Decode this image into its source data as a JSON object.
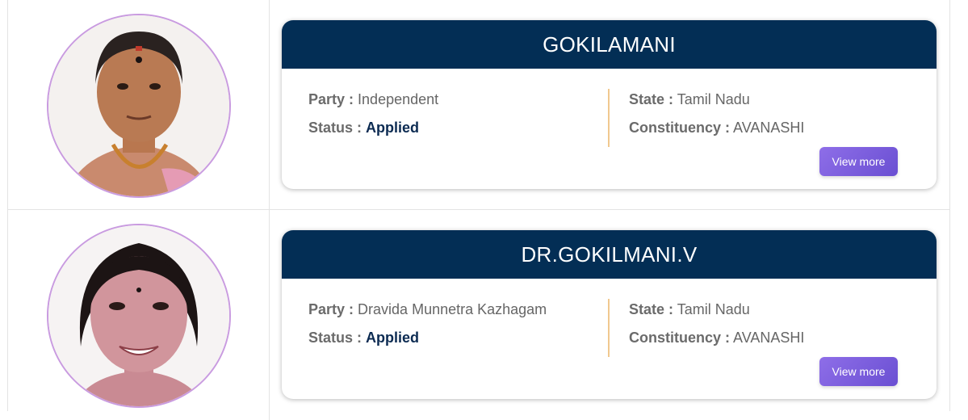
{
  "candidates": [
    {
      "name": "GOKILAMANI",
      "party_label": "Party :",
      "party": "Independent",
      "status_label": "Status :",
      "status": "Applied",
      "state_label": "State :",
      "state": "Tamil Nadu",
      "constituency_label": "Constituency :",
      "constituency": "AVANASHI",
      "button": "View more"
    },
    {
      "name": "DR.GOKILMANI.V",
      "party_label": "Party :",
      "party": "Dravida Munnetra Kazhagam",
      "status_label": "Status :",
      "status": "Applied",
      "state_label": "State :",
      "state": "Tamil Nadu",
      "constituency_label": "Constituency :",
      "constituency": "AVANASHI",
      "button": "View more"
    }
  ],
  "colors": {
    "header_bg": "#032e55",
    "button": "#7b5fe0",
    "avatar_ring": "#c99be0",
    "divider": "#f1c88f"
  }
}
